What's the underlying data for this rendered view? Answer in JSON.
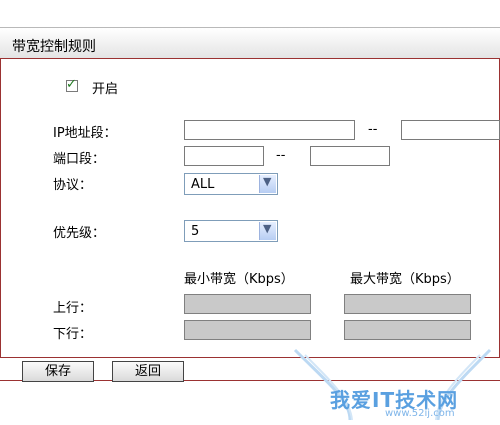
{
  "panel": {
    "title": "带宽控制规则"
  },
  "enable": {
    "label": "开启",
    "checked": true
  },
  "ip_range": {
    "label": "IP地址段：",
    "separator": "--",
    "start": "",
    "end": ""
  },
  "port_range": {
    "label": "端口段：",
    "separator": "--",
    "start": "",
    "end": ""
  },
  "protocol": {
    "label": "协议：",
    "selected": "ALL"
  },
  "priority": {
    "label": "优先级：",
    "selected": "5"
  },
  "bandwidth": {
    "min_header": "最小带宽（Kbps）",
    "max_header": "最大带宽（Kbps）",
    "upstream_label": "上行：",
    "downstream_label": "下行："
  },
  "actions": {
    "save_label": "保存",
    "back_label": "返回"
  },
  "watermark": {
    "text": "我爱IT技术网",
    "url": "www.52ij.com"
  },
  "colors": {
    "accent_border": "#9b3232",
    "select_border": "#7f9db9",
    "disabled_input": "#c9c9c9"
  }
}
